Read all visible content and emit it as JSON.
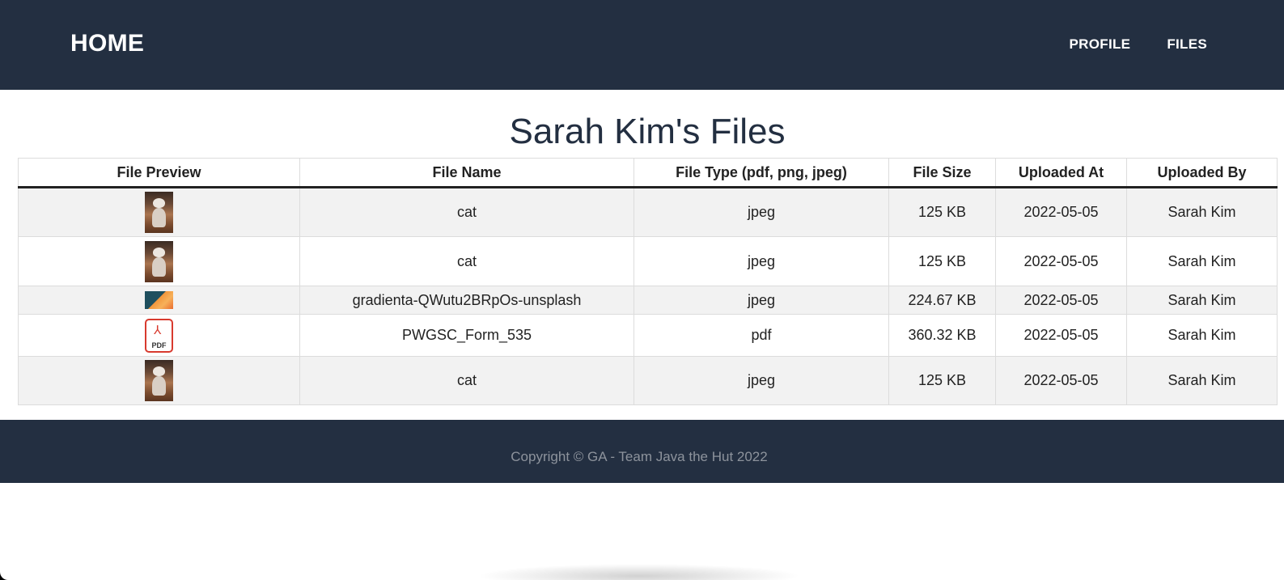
{
  "nav": {
    "brand": "HOME",
    "links": [
      "PROFILE",
      "FILES"
    ]
  },
  "page_title": "Sarah Kim's Files",
  "table": {
    "headers": [
      "File Preview",
      "File Name",
      "File Type (pdf, png, jpeg)",
      "File Size",
      "Uploaded At",
      "Uploaded By"
    ],
    "rows": [
      {
        "preview": "cat-photo-thumbnail",
        "name": "cat",
        "type": "jpeg",
        "size": "125 KB",
        "uploaded_at": "2022-05-05",
        "uploaded_by": "Sarah Kim"
      },
      {
        "preview": "cat-photo-thumbnail",
        "name": "cat",
        "type": "jpeg",
        "size": "125 KB",
        "uploaded_at": "2022-05-05",
        "uploaded_by": "Sarah Kim"
      },
      {
        "preview": "gradient-image-thumbnail",
        "name": "gradienta-QWutu2BRpOs-unsplash",
        "type": "jpeg",
        "size": "224.67 KB",
        "uploaded_at": "2022-05-05",
        "uploaded_by": "Sarah Kim"
      },
      {
        "preview": "pdf-icon",
        "name": "PWGSC_Form_535",
        "type": "pdf",
        "size": "360.32 KB",
        "uploaded_at": "2022-05-05",
        "uploaded_by": "Sarah Kim"
      },
      {
        "preview": "cat-photo-thumbnail",
        "name": "cat",
        "type": "jpeg",
        "size": "125 KB",
        "uploaded_at": "2022-05-05",
        "uploaded_by": "Sarah Kim"
      }
    ]
  },
  "pdf_icon_label": "PDF",
  "footer": {
    "copyright": "Copyright © GA - Team Java the Hut 2022"
  },
  "colors": {
    "navbar_bg": "#232f41",
    "title_color": "#232f41",
    "row_alt_bg": "#f2f2f2",
    "pdf_red": "#d83a2e"
  }
}
